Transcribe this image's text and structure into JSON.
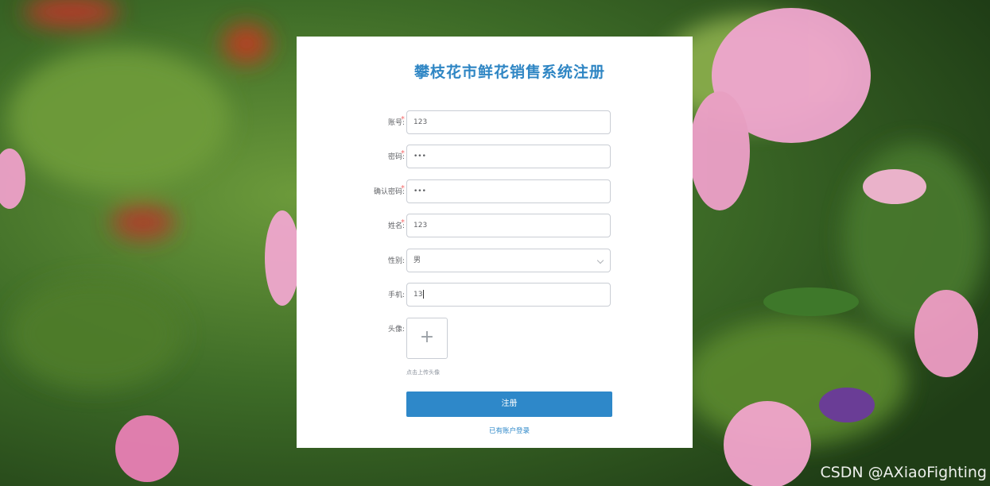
{
  "form": {
    "title": "攀枝花市鲜花销售系统注册",
    "fields": [
      {
        "label": "账号:",
        "required": true,
        "value": "123",
        "type": "text"
      },
      {
        "label": "密码:",
        "required": true,
        "value": "•••",
        "type": "password"
      },
      {
        "label": "确认密码:",
        "required": true,
        "value": "•••",
        "type": "password"
      },
      {
        "label": "姓名:",
        "required": true,
        "value": "123",
        "type": "text"
      },
      {
        "label": "性别:",
        "required": false,
        "value": "男",
        "type": "select"
      },
      {
        "label": "手机:",
        "required": false,
        "value": "13",
        "type": "text"
      }
    ],
    "avatar": {
      "label": "头像:",
      "hint": "点击上传头像"
    },
    "submit_label": "注册",
    "login_link": "已有账户登录"
  },
  "watermark": "CSDN @AXiaoFighting",
  "colors": {
    "accent": "#2e88c9",
    "required": "#f56c6c"
  }
}
